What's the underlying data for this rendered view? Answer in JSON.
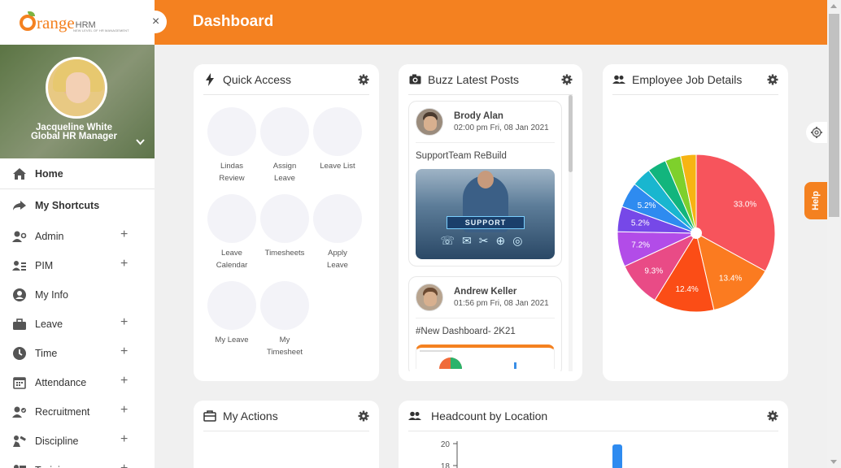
{
  "brand": {
    "logo_text": "range",
    "logo_suffix": "HRM",
    "tagline": "NEW LEVEL OF HR MANAGEMENT",
    "close_label": "×"
  },
  "profile": {
    "name": "Jacqueline White",
    "title": "Global HR Manager"
  },
  "sidebar": {
    "items": [
      {
        "label": "Home",
        "icon": "home-icon",
        "expandable": false
      },
      {
        "label": "My Shortcuts",
        "icon": "share-icon",
        "expandable": false
      },
      {
        "label": "Admin",
        "icon": "admin-icon",
        "expandable": true
      },
      {
        "label": "PIM",
        "icon": "pim-icon",
        "expandable": true
      },
      {
        "label": "My Info",
        "icon": "user-icon",
        "expandable": false
      },
      {
        "label": "Leave",
        "icon": "briefcase-icon",
        "expandable": true
      },
      {
        "label": "Time",
        "icon": "clock-icon",
        "expandable": true
      },
      {
        "label": "Attendance",
        "icon": "calendar-icon",
        "expandable": true
      },
      {
        "label": "Recruitment",
        "icon": "recruitment-icon",
        "expandable": true
      },
      {
        "label": "Discipline",
        "icon": "discipline-icon",
        "expandable": true
      },
      {
        "label": "Training",
        "icon": "training-icon",
        "expandable": true
      }
    ],
    "plus": "+"
  },
  "header": {
    "title": "Dashboard"
  },
  "quick_access": {
    "title": "Quick Access",
    "items": [
      {
        "l1": "Lindas",
        "l2": "Review"
      },
      {
        "l1": "Assign",
        "l2": "Leave"
      },
      {
        "l1": "Leave List",
        "l2": ""
      },
      {
        "l1": "Leave",
        "l2": "Calendar"
      },
      {
        "l1": "Timesheets",
        "l2": ""
      },
      {
        "l1": "Apply",
        "l2": "Leave"
      },
      {
        "l1": "My Leave",
        "l2": ""
      },
      {
        "l1": "My",
        "l2": "Timesheet"
      }
    ]
  },
  "buzz": {
    "title": "Buzz Latest Posts",
    "posts": [
      {
        "name": "Brody Alan",
        "time": "02:00 pm Fri, 08 Jan 2021",
        "text": "SupportTeam ReBuild",
        "image_caption": "SUPPORT",
        "image_icons": "☏✉✂⊕◎"
      },
      {
        "name": "Andrew Keller",
        "time": "01:56 pm Fri, 08 Jan 2021",
        "text": "#New Dashboard- 2K21"
      }
    ]
  },
  "job_details": {
    "title": "Employee Job Details",
    "colors": {
      "red": "#f7545c",
      "orange": "#fb7b20",
      "deep_orange": "#fb4d16",
      "pink": "#e94b86",
      "purple": "#b24ce8",
      "violet": "#7648e8",
      "blue": "#2e8bf0",
      "cyan": "#19b6cf",
      "teal": "#12b57d",
      "green": "#7ed02c",
      "yellow": "#f7b413"
    }
  },
  "chart_data": {
    "type": "pie",
    "title": "",
    "slices": [
      {
        "value": 33.0,
        "label": "33.0%",
        "color": "#f7545c"
      },
      {
        "value": 13.4,
        "label": "13.4%",
        "color": "#fb7b20"
      },
      {
        "value": 12.4,
        "label": "12.4%",
        "color": "#fb4d16"
      },
      {
        "value": 9.3,
        "label": "9.3%",
        "color": "#e94b86"
      },
      {
        "value": 7.2,
        "label": "7.2%",
        "color": "#b24ce8"
      },
      {
        "value": 5.2,
        "label": "5.2%",
        "color": "#7648e8"
      },
      {
        "value": 5.2,
        "label": "5.2%",
        "color": "#2e8bf0"
      },
      {
        "value": 4.0,
        "label": "",
        "color": "#19b6cf"
      },
      {
        "value": 3.9,
        "label": "",
        "color": "#12b57d"
      },
      {
        "value": 3.2,
        "label": "",
        "color": "#7ed02c"
      },
      {
        "value": 3.2,
        "label": "",
        "color": "#f7b413"
      }
    ]
  },
  "my_actions": {
    "title": "My Actions"
  },
  "headcount": {
    "title": "Headcount by Location",
    "y_ticks": [
      "20",
      "18"
    ]
  },
  "help": {
    "label": "Help"
  }
}
